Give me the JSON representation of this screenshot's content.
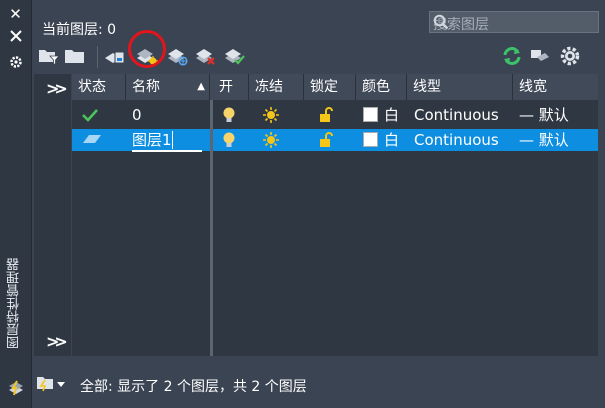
{
  "palette": {
    "title": "图层特性管理器",
    "close": "✕"
  },
  "header": {
    "current_layer": "当前图层: 0"
  },
  "search": {
    "placeholder": "搜索图层"
  },
  "columns": [
    "状态",
    "名称",
    "开",
    "冻结",
    "锁定",
    "颜色",
    "线型",
    "线宽"
  ],
  "rows": [
    {
      "name": "0",
      "color": "白",
      "linetype": "Continuous",
      "lineweight": "— 默认",
      "selected": false,
      "status": "current"
    },
    {
      "name": "图层1",
      "color": "白",
      "linetype": "Continuous",
      "lineweight": "— 默认",
      "selected": true,
      "status": "layer"
    }
  ],
  "statusbar": {
    "text": "全部: 显示了 2 个图层，共 2 个图层"
  },
  "colors": {
    "accent": "#0d8ee1",
    "highlight_circle": "#e2151c"
  }
}
